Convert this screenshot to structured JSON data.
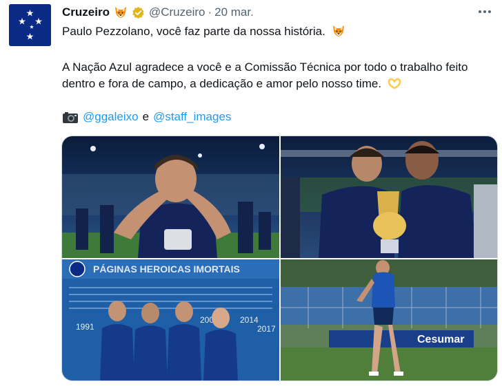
{
  "account": {
    "name": "Cruzeiro",
    "handle": "@Cruzeiro",
    "separator": "·",
    "date": "20 mar."
  },
  "tweet": {
    "line1": "Paulo Pezzolano, você faz parte da nossa história.",
    "para2": "A Nação Azul agradece a você e a Comissão Técnica por todo o trabalho feito dentro e fora de campo, a dedicação e amor pelo nosso time.",
    "mention1": "@ggaleixo",
    "conjunction": "e",
    "mention2": "@staff_images"
  },
  "media": {
    "photo3_banner": "PÁGINAS HEROICAS IMORTAIS",
    "photo3_years": [
      "1991",
      "2003",
      "2014",
      "2017"
    ],
    "photo4_sponsor": "Cesumar"
  },
  "icons": {
    "fox_emoji": "fox-icon",
    "verified": "verified-gold-badge-icon",
    "heart_hands": "heart-hands-icon",
    "camera": "camera-icon",
    "more": "more-options-icon"
  },
  "colors": {
    "link": "#1d9bf0",
    "secondary_text": "#536471",
    "primary_text": "#0f1419",
    "verified_gold": "#e2b719",
    "club_blue": "#0b2a86"
  }
}
